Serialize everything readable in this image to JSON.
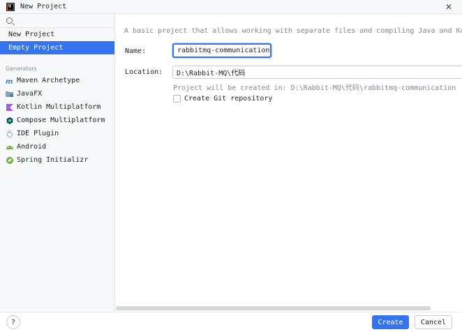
{
  "window": {
    "title": "New Project",
    "close_glyph": "✕"
  },
  "sidebar": {
    "top_items": [
      {
        "label": "New Project",
        "selected": false
      },
      {
        "label": "Empty Project",
        "selected": true
      }
    ],
    "generators_label": "Generators",
    "generators": [
      {
        "label": "Maven Archetype",
        "icon": "maven-icon"
      },
      {
        "label": "JavaFX",
        "icon": "javafx-icon"
      },
      {
        "label": "Kotlin Multiplatform",
        "icon": "kotlin-icon"
      },
      {
        "label": "Compose Multiplatform",
        "icon": "compose-icon"
      },
      {
        "label": "IDE Plugin",
        "icon": "ide-plugin-icon"
      },
      {
        "label": "Android",
        "icon": "android-icon"
      },
      {
        "label": "Spring Initializr",
        "icon": "spring-icon"
      }
    ]
  },
  "main": {
    "description": "A basic project that allows working with separate files and compiling Java and Kotlin cl",
    "name_label": "Name:",
    "name_value": "rabbitmq-communication",
    "location_label": "Location:",
    "location_value": "D:\\Rabbit-MQ\\代码",
    "hint": "Project will be created in: D:\\Rabbit-MQ\\代码\\rabbitmq-communication",
    "git_checkbox_label": "Create Git repository",
    "git_checked": false
  },
  "footer": {
    "help_label": "?",
    "create_label": "Create",
    "cancel_label": "Cancel"
  },
  "colors": {
    "accent": "#3574f0",
    "sidebar_bg": "#f7f8fa",
    "hint_text": "#818594"
  }
}
